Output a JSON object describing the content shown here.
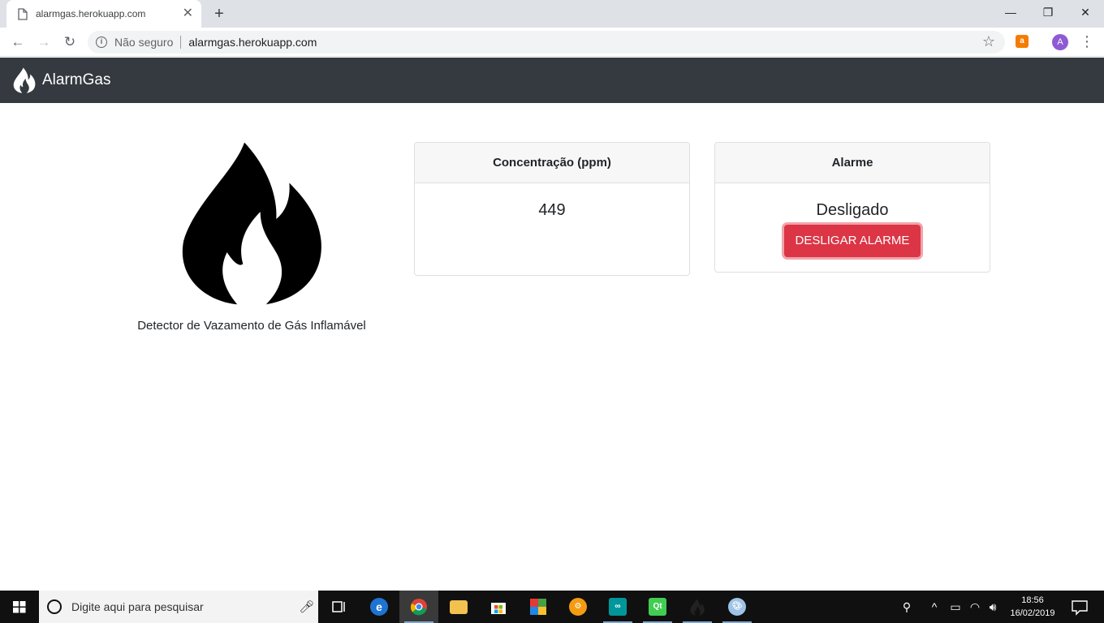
{
  "browser": {
    "tab_title": "alarmgas.herokuapp.com",
    "new_tab": "+",
    "security_label": "Não seguro",
    "url": "alarmgas.herokuapp.com",
    "avatar_letter": "A"
  },
  "navbar": {
    "brand": "AlarmGas"
  },
  "hero": {
    "caption": "Detector de Vazamento de Gás Inflamável"
  },
  "cards": {
    "concentration": {
      "title": "Concentração (ppm)",
      "value": "449"
    },
    "alarm": {
      "title": "Alarme",
      "status": "Desligado",
      "button_label": "DESLIGAR ALARME",
      "button_color": "#dc3545"
    }
  },
  "taskbar": {
    "search_placeholder": "Digite aqui para pesquisar",
    "time": "18:56",
    "date": "16/02/2019"
  },
  "icons": [
    "page-icon",
    "back-icon",
    "forward-icon",
    "reload-icon",
    "info-icon",
    "star-icon",
    "extension-icon",
    "menu-icon",
    "flame-icon",
    "windows-icon",
    "cortana-icon",
    "mic-icon",
    "task-view-icon",
    "edge-icon",
    "chrome-icon",
    "file-explorer-icon",
    "store-icon",
    "notification-icon"
  ],
  "colors": {
    "navbar_bg": "#343a40",
    "danger": "#dc3545",
    "card_header_bg": "#f7f7f7"
  }
}
